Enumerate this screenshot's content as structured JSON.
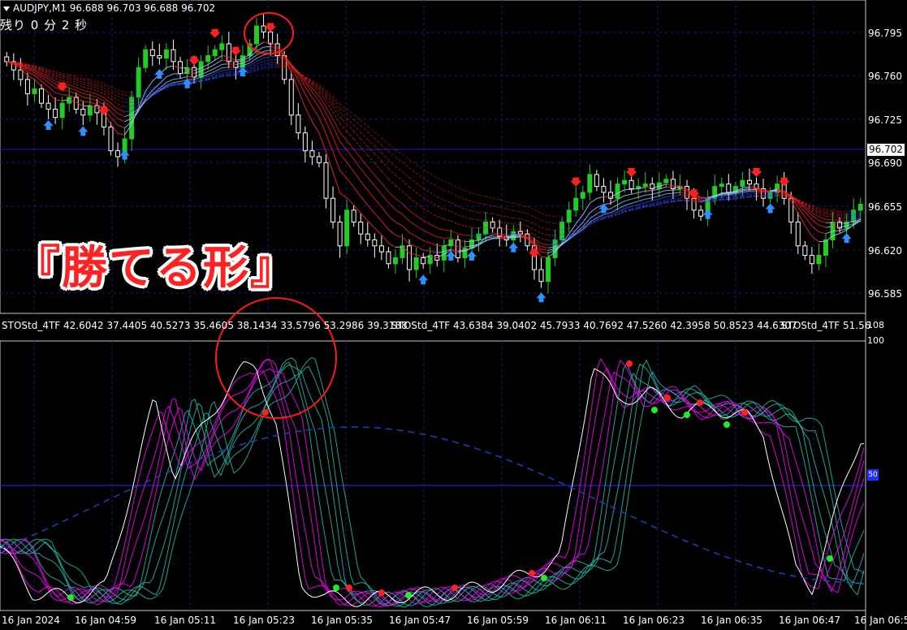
{
  "header": {
    "symbol_line": "AUDJPY,M1  96.688 96.703 96.688 96.702",
    "timer": "残り 0 分 2 秒"
  },
  "caption": "『勝てる形』",
  "indicator_label": [
    "STOStd_4TF 42.6042 37.4405 40.5273 35.4605 38.1434 33.5796 53.2986 39.3188",
    "STOStd_4TF 43.6384 39.0402 45.7933 40.7692 47.5260 42.3958 50.8523 44.6307",
    "STOStd_4TF 51.56"
  ],
  "price_axis": [
    "96.795",
    "96.760",
    "96.725",
    "96.690",
    "96.655",
    "96.620",
    "96.585"
  ],
  "current_price": "96.702",
  "osc_axis": {
    "top": "108",
    "max": "100",
    "level_tag": "50"
  },
  "time_axis": [
    "16 Jan 2024",
    "16 Jan 04:59",
    "16 Jan 05:11",
    "16 Jan 05:23",
    "16 Jan 05:35",
    "16 Jan 05:47",
    "16 Jan 05:59",
    "16 Jan 06:11",
    "16 Jan 06:23",
    "16 Jan 06:35",
    "16 Jan 06:47",
    "16 Jan 06:5"
  ],
  "colors": {
    "bull": "#22cc22",
    "bear": "#ffffff",
    "up_arrow": "#2f8fff",
    "down_arrow": "#ff2020",
    "grid": "#1c1c8a",
    "ribbon_red": "#ff2020",
    "ribbon_blue": "#3050ff",
    "osc_white": "#ffffff",
    "osc_magenta": "#ff00ff",
    "osc_teal": "#20c0b0",
    "circle": "#ff1a1a"
  },
  "chart_data": [
    {
      "type": "candlestick",
      "title": "AUDJPY,M1",
      "ylim": [
        96.57,
        96.82
      ],
      "x": [
        "04:47",
        "04:48",
        "04:49",
        "04:50",
        "04:51",
        "04:52",
        "04:53",
        "04:54",
        "04:55",
        "04:56",
        "04:57",
        "04:58",
        "04:59",
        "05:00",
        "05:01",
        "05:02",
        "05:03",
        "05:04",
        "05:05",
        "05:06",
        "05:07",
        "05:08",
        "05:09",
        "05:10",
        "05:11",
        "05:12",
        "05:13",
        "05:14",
        "05:15",
        "05:16",
        "05:17",
        "05:18",
        "05:19",
        "05:20",
        "05:21",
        "05:22",
        "05:23",
        "05:24",
        "05:25",
        "05:26",
        "05:27",
        "05:28",
        "05:29",
        "05:30",
        "05:31",
        "05:32",
        "05:33",
        "05:34",
        "05:35",
        "05:36",
        "05:37",
        "05:38",
        "05:39",
        "05:40",
        "05:41",
        "05:42",
        "05:43",
        "05:44",
        "05:45",
        "05:46",
        "05:47",
        "05:48",
        "05:49",
        "05:50",
        "05:51",
        "05:52",
        "05:53",
        "05:54",
        "05:55",
        "05:56",
        "05:57",
        "05:58",
        "05:59",
        "06:00",
        "06:01",
        "06:02",
        "06:03",
        "06:04",
        "06:05",
        "06:06",
        "06:07",
        "06:08",
        "06:09",
        "06:10",
        "06:11",
        "06:12",
        "06:13",
        "06:14",
        "06:15",
        "06:16",
        "06:17",
        "06:18",
        "06:19",
        "06:20",
        "06:21",
        "06:22",
        "06:23",
        "06:24",
        "06:25",
        "06:26",
        "06:27",
        "06:28",
        "06:29",
        "06:30",
        "06:31",
        "06:32",
        "06:33",
        "06:34",
        "06:35",
        "06:36",
        "06:37",
        "06:38",
        "06:39",
        "06:40",
        "06:41",
        "06:42",
        "06:43",
        "06:44",
        "06:45",
        "06:46",
        "06:47",
        "06:48",
        "06:49",
        "06:50",
        "06:51",
        "06:52"
      ],
      "close": [
        96.775,
        96.768,
        96.76,
        96.748,
        96.752,
        96.74,
        96.735,
        96.728,
        96.74,
        96.745,
        96.735,
        96.73,
        96.738,
        96.732,
        96.72,
        96.7,
        96.695,
        96.71,
        96.745,
        96.77,
        96.785,
        96.78,
        96.778,
        96.785,
        96.775,
        96.765,
        96.77,
        96.762,
        96.775,
        96.78,
        96.785,
        96.79,
        96.775,
        96.77,
        96.78,
        96.79,
        96.805,
        96.8,
        96.79,
        96.78,
        96.76,
        96.73,
        96.715,
        96.7,
        96.695,
        96.69,
        96.66,
        96.64,
        96.62,
        96.65,
        96.64,
        96.63,
        96.625,
        96.62,
        96.615,
        96.605,
        96.61,
        96.62,
        96.6,
        96.61,
        96.605,
        96.612,
        96.608,
        96.62,
        96.625,
        96.61,
        96.618,
        96.625,
        96.63,
        96.64,
        96.635,
        96.628,
        96.625,
        96.632,
        96.63,
        96.62,
        96.6,
        96.59,
        96.61,
        96.625,
        96.64,
        96.65,
        96.66,
        96.665,
        96.68,
        96.67,
        96.665,
        96.66,
        96.672,
        96.675,
        96.668,
        96.67,
        96.672,
        96.668,
        96.673,
        96.676,
        96.668,
        96.67,
        96.66,
        96.65,
        96.645,
        96.66,
        96.67,
        96.672,
        96.665,
        96.67,
        96.675,
        96.672,
        96.668,
        96.66,
        96.665,
        96.672,
        96.66,
        96.64,
        96.62,
        96.612,
        96.605,
        96.612,
        96.625,
        96.64,
        96.635,
        96.64,
        96.65,
        96.655
      ]
    },
    {
      "type": "line",
      "title": "STOStd_4TF",
      "ylim": [
        0,
        108
      ],
      "reference_level": 50,
      "series": [
        {
          "name": "STOStd_4TF",
          "values": [
            42.6042,
            37.4405,
            40.5273,
            35.4605,
            38.1434,
            33.5796,
            53.2986,
            39.3188
          ]
        },
        {
          "name": "STOStd_4TF",
          "values": [
            43.6384,
            39.0402,
            45.7933,
            40.7692,
            47.526,
            42.3958,
            50.8523,
            44.6307
          ]
        }
      ]
    }
  ]
}
